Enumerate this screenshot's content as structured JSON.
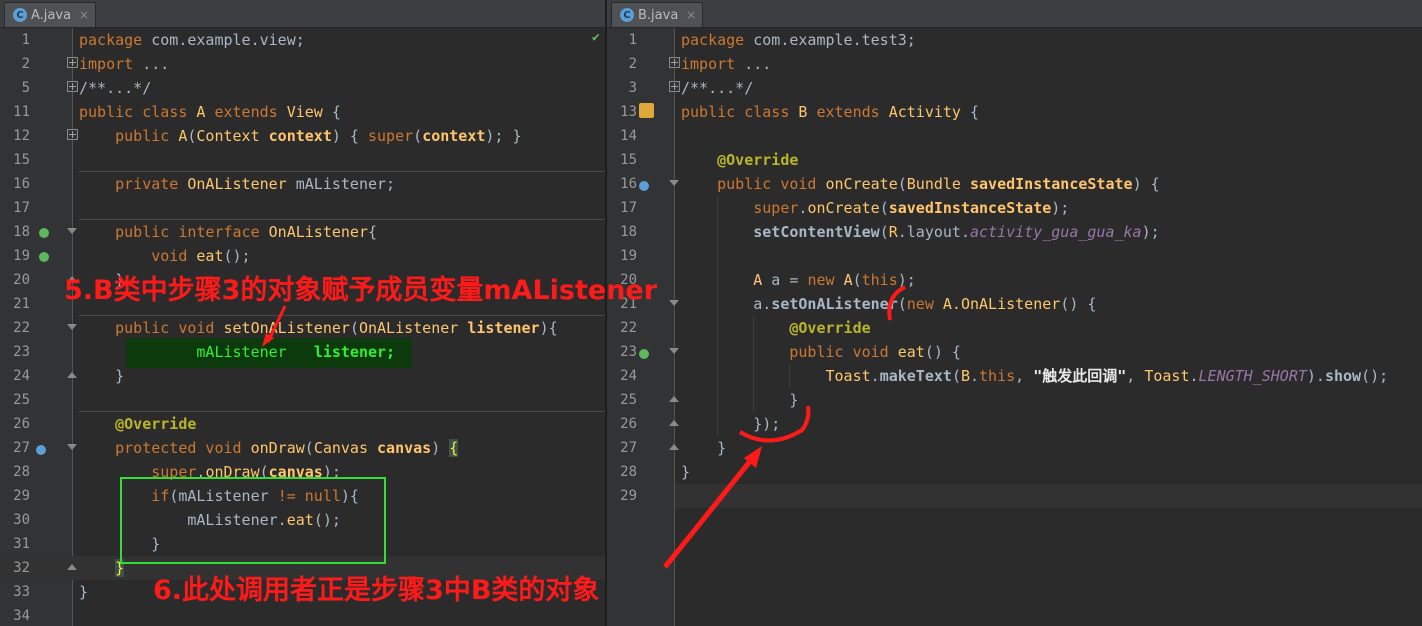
{
  "tabs": {
    "left": {
      "icon": "C",
      "label": "A.java",
      "close": "×"
    },
    "right": {
      "icon": "C",
      "label": "B.java",
      "close": "×"
    }
  },
  "fileA": {
    "lines": [
      "1",
      "2",
      "5",
      "11",
      "12",
      "15",
      "16",
      "17",
      "18",
      "19",
      "20",
      "21",
      "22",
      "23",
      "24",
      "25",
      "26",
      "27",
      "28",
      "29",
      "30",
      "31",
      "32",
      "33",
      "34"
    ]
  },
  "fileB": {
    "lines": [
      "1",
      "2",
      "3",
      "13",
      "14",
      "15",
      "16",
      "17",
      "18",
      "19",
      "20",
      "21",
      "22",
      "23",
      "24",
      "25",
      "26",
      "27",
      "28",
      "29"
    ],
    "toast_text": "\"触发此回调\""
  },
  "annotations": {
    "step5": "5.B类中步骤3的对象赋予成员变量mAListener",
    "step6": "6.此处调用者正是步骤3中B类的对象"
  },
  "colors": {
    "background": "#2b2b2b",
    "gutter": "#313335",
    "keyword": "#cc7832",
    "annotation_red": "#ff1a1a",
    "highlight_box": "#33dd33"
  },
  "icons": [
    "java-class-icon",
    "close-icon",
    "fold-icon",
    "implemented-icon",
    "override-icon",
    "android-activity-icon",
    "check-icon"
  ]
}
